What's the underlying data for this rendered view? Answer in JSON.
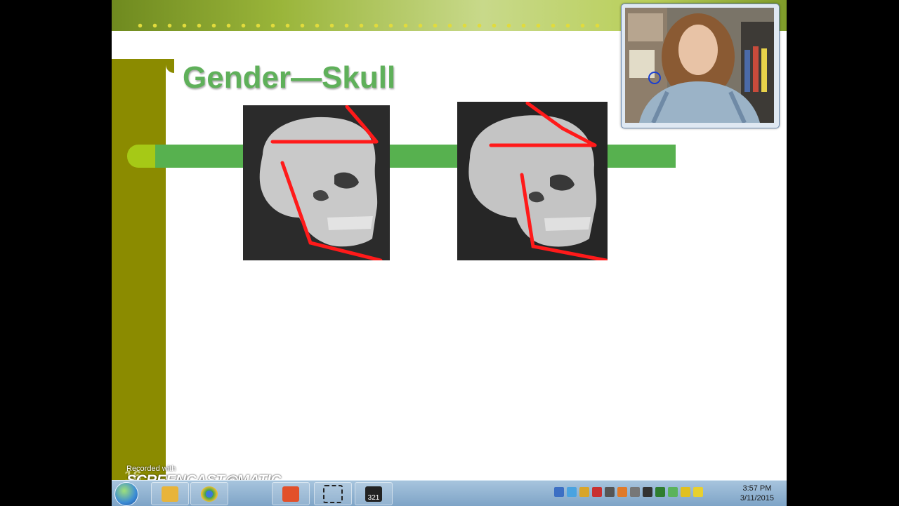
{
  "slide": {
    "title": "Gender—Skull",
    "page_number": "16"
  },
  "watermark": {
    "line1": "Recorded with",
    "line2": "SCREENCAST◎MATIC"
  },
  "taskbar": {
    "items": [
      {
        "name": "start-button",
        "icon": "windows-orb"
      },
      {
        "name": "taskbar-folder",
        "icon": "folder-icon",
        "color": "#e8b43a"
      },
      {
        "name": "taskbar-chrome",
        "icon": "chrome-icon",
        "color": "#3aa24a"
      },
      {
        "name": "taskbar-screencast",
        "icon": "screencast-icon",
        "color": "#e2502a"
      },
      {
        "name": "taskbar-capture",
        "icon": "capture-region-icon",
        "color": "#333333"
      },
      {
        "name": "taskbar-video",
        "icon": "video-clapper-icon",
        "color": "#222222",
        "label": "321"
      }
    ],
    "clock": {
      "time": "3:57 PM",
      "date": "3/11/2015"
    }
  },
  "colors": {
    "title_green": "#5fb05a",
    "band_green": "#57b14f",
    "sidebar_olive": "#8b8b00",
    "annotation_red": "#ff1a1a"
  }
}
